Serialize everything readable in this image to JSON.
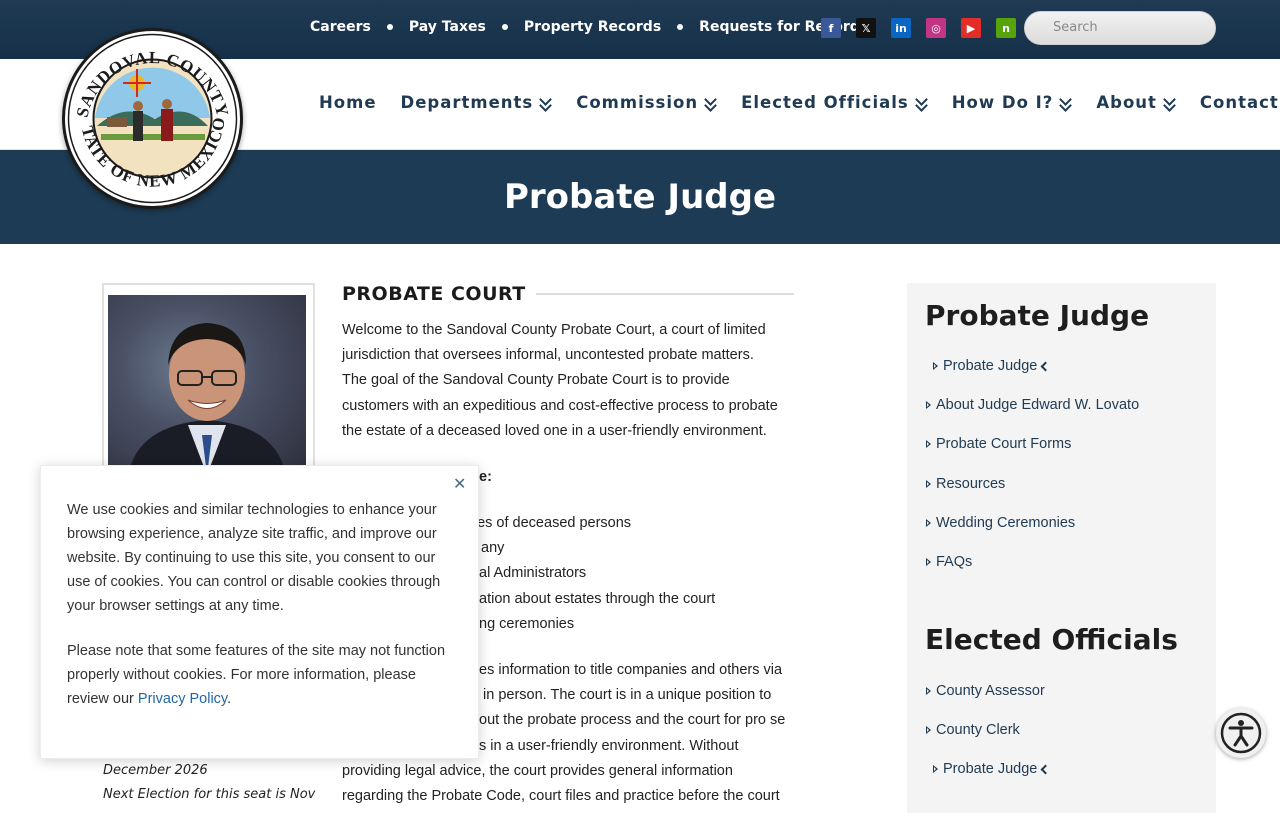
{
  "topbar": {
    "links": [
      "Careers",
      "Pay Taxes",
      "Property Records",
      "Requests for Records"
    ],
    "socials": [
      {
        "icon": "facebook-icon",
        "glyph": "f",
        "color": "#3b5998"
      },
      {
        "icon": "x-twitter-icon",
        "glyph": "𝕏",
        "color": "#111111"
      },
      {
        "icon": "linkedin-icon",
        "glyph": "in",
        "color": "#0a66c2"
      },
      {
        "icon": "instagram-icon",
        "glyph": "◎",
        "color": "#c13584"
      },
      {
        "icon": "youtube-icon",
        "glyph": "▶",
        "color": "#e52d27"
      },
      {
        "icon": "nextdoor-icon",
        "glyph": "n",
        "color": "#57a30b"
      }
    ],
    "search_placeholder": "Search"
  },
  "logo": {
    "top_text": "SANDOVAL COUNTY",
    "bottom_text": "STATE OF NEW MEXICO"
  },
  "nav": {
    "items": [
      {
        "label": "Home",
        "dropdown": false
      },
      {
        "label": "Departments",
        "dropdown": true
      },
      {
        "label": "Commission",
        "dropdown": true
      },
      {
        "label": "Elected Officials",
        "dropdown": true
      },
      {
        "label": "How Do I?",
        "dropdown": true
      },
      {
        "label": "About",
        "dropdown": true
      },
      {
        "label": "Contact",
        "dropdown": false
      }
    ]
  },
  "banner": {
    "title": "Probate Judge"
  },
  "main": {
    "heading": "PROBATE COURT",
    "intro_lines": [
      "Welcome to the Sandoval County Probate Court, a court of limited",
      "jurisdiction that oversees informal, uncontested probate matters.",
      "The goal of the Sandoval County Probate Court is to provide",
      "customers with an expeditious and cost-effective process to probate",
      "the estate of a deceased loved one in a user-friendly environment."
    ],
    "list_heading_partial": "e:",
    "list_partial": [
      "ates of deceased persons",
      "any",
      "al Administrators",
      "ation about estates through the court",
      "ng ceremonies"
    ],
    "para2_lines": [
      "es information to title companies and others via",
      " in person. The court is in a unique position to",
      "out the probate process and the court for pro se",
      "s in a user-friendly environment. Without",
      "providing legal advice, the court provides general information",
      "regarding the Probate Code, court files and practice before the court"
    ]
  },
  "judge_note": {
    "line1": "December 2026",
    "line2": "Next Election for this seat is Nov"
  },
  "sidebar": {
    "section1_title": "Probate Judge",
    "section1_items": [
      {
        "label": "Probate Judge",
        "current": true
      },
      {
        "label": "About Judge Edward W. Lovato",
        "current": false
      },
      {
        "label": "Probate Court Forms",
        "current": false
      },
      {
        "label": "Resources",
        "current": false
      },
      {
        "label": "Wedding Ceremonies",
        "current": false
      },
      {
        "label": "FAQs",
        "current": false
      }
    ],
    "section2_title": "Elected Officials",
    "section2_items": [
      {
        "label": "County Assessor",
        "current": false
      },
      {
        "label": "County Clerk",
        "current": false
      },
      {
        "label": "Probate Judge",
        "current": true
      }
    ]
  },
  "cookie": {
    "para1": "We use cookies and similar technologies to enhance your browsing experience, analyze site traffic, and improve our website. By continuing to use this site, you consent to our use of cookies. You can control or disable cookies through your browser settings at any time.",
    "para2_prefix": "Please note that some features of the site may not function properly without cookies. For more information, please review our ",
    "link_label": "Privacy Policy",
    "para2_suffix": ".",
    "close_glyph": "✕"
  },
  "accessibility": {
    "icon": "accessibility-icon"
  }
}
